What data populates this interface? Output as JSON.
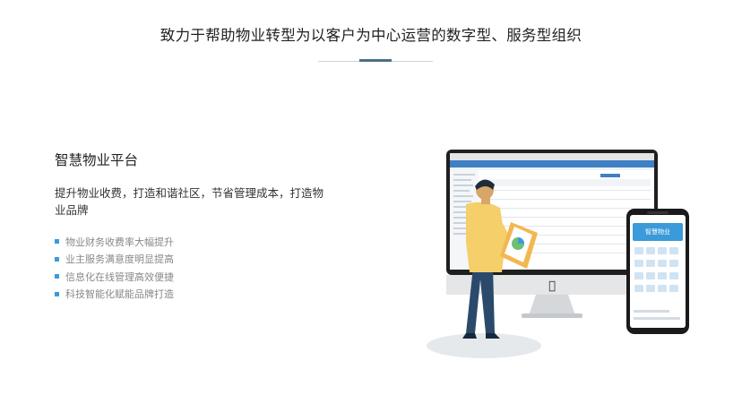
{
  "header": {
    "headline": "致力于帮助物业转型为以客户为中心运营的数字型、服务型组织"
  },
  "product": {
    "title": "智慧物业平台",
    "description": "提升物业收费，打造和谐社区，节省管理成本，打造物业品牌",
    "features": [
      "物业财务收费率大幅提升",
      "业主服务满意度明显提高",
      "信息化在线管理高效便捷",
      "科技智能化赋能品牌打造"
    ]
  },
  "illustration": {
    "phone_banner_text": "智慧物业"
  },
  "colors": {
    "accent": "#3b9ad9",
    "divider_accent": "#4d6f86",
    "shirt": "#f4cf6a",
    "pants": "#2b4a6b"
  }
}
